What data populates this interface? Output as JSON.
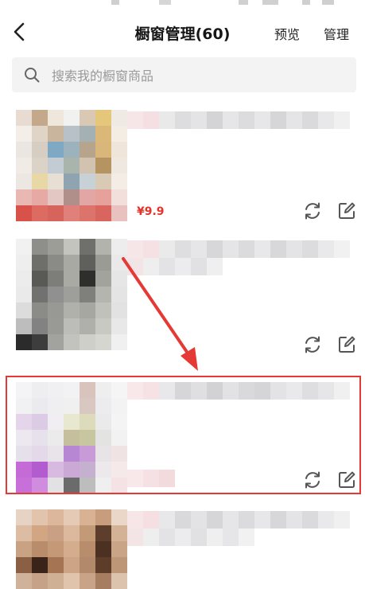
{
  "header": {
    "title": "橱窗管理(60)",
    "preview_label": "预览",
    "manage_label": "管理"
  },
  "search": {
    "placeholder": "搜索我的橱窗商品"
  },
  "products": [
    {
      "price": "¥9.9"
    },
    {
      "price": ""
    },
    {
      "price": ""
    },
    {
      "price": ""
    }
  ],
  "colors": {
    "accent": "#e3332b",
    "highlight": "#e53935",
    "search_bg": "#f3f3f4"
  },
  "icons": [
    "back-icon",
    "search-icon",
    "refresh-icon",
    "edit-icon",
    "arrow-annotation"
  ]
}
